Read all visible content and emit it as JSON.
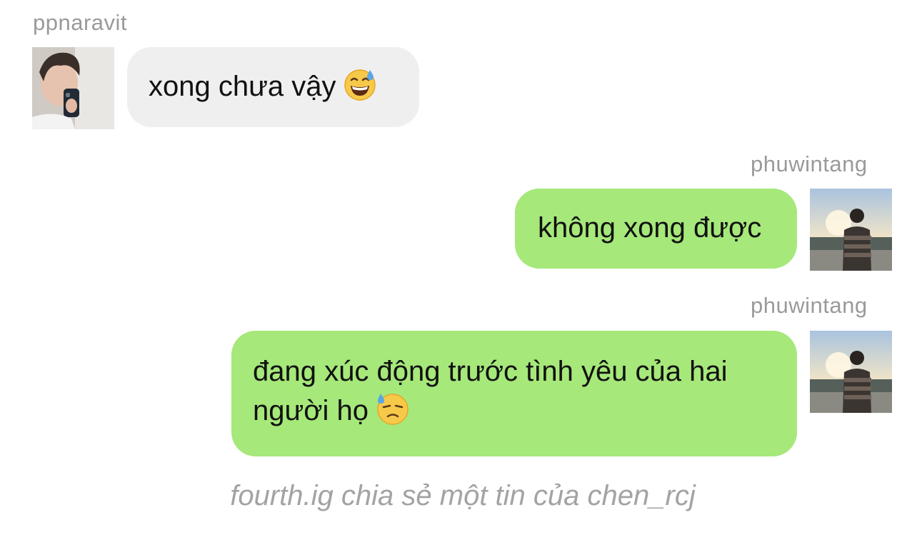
{
  "messages": [
    {
      "sender": "ppnaravit",
      "direction": "incoming",
      "text": "xong chưa vậy",
      "emoji": "grinning-face-with-sweat-icon"
    },
    {
      "sender": "phuwintang",
      "direction": "outgoing",
      "text": "không xong được"
    },
    {
      "sender": "phuwintang",
      "direction": "outgoing",
      "line1": "đang xúc động trước tình yêu của hai",
      "line2": "người họ",
      "emoji": "downcast-face-with-sweat-icon"
    }
  ],
  "caption": "fourth.ig chia sẻ một tin của chen_rcj",
  "colors": {
    "incoming_bubble": "#efefef",
    "outgoing_bubble": "#a6e87a",
    "username": "#9a9a9a",
    "caption": "#a3a3a3"
  }
}
